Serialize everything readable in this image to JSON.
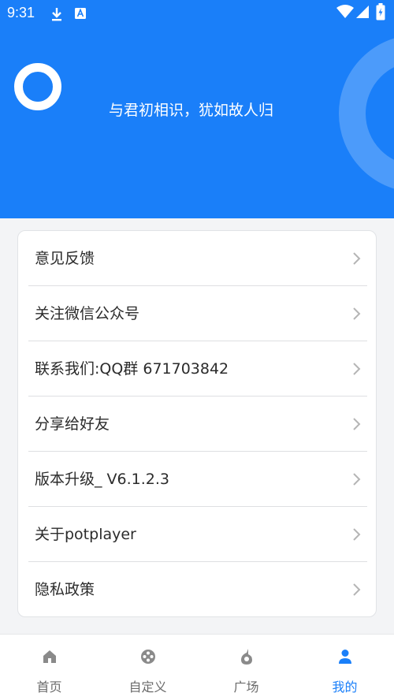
{
  "status_bar": {
    "time": "9:31",
    "icons": [
      "download-icon",
      "a-badge-icon",
      "wifi-icon",
      "signal-icon",
      "battery-charging-icon"
    ]
  },
  "profile": {
    "motto": "与君初相识，犹如故人归"
  },
  "menu": {
    "items": [
      {
        "label": "意见反馈"
      },
      {
        "label": "关注微信公众号"
      },
      {
        "label": "联系我们:QQ群 671703842"
      },
      {
        "label": "分享给好友"
      },
      {
        "label": "版本升级_ V6.1.2.3"
      },
      {
        "label": "关于potplayer"
      },
      {
        "label": "隐私政策"
      }
    ]
  },
  "tabs": [
    {
      "label": "首页",
      "icon": "home-icon",
      "active": false
    },
    {
      "label": "自定义",
      "icon": "film-reel-icon",
      "active": false
    },
    {
      "label": "广场",
      "icon": "plaza-icon",
      "active": false
    },
    {
      "label": "我的",
      "icon": "person-icon",
      "active": true
    }
  ],
  "colors": {
    "accent": "#1a7ff9",
    "header_bg": "#1a7ff9",
    "text": "#2b2b2b",
    "tab_inactive": "#6b6b6b"
  }
}
